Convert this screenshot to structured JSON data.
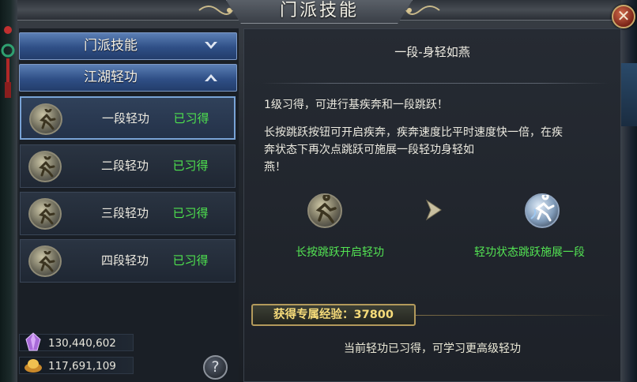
{
  "window": {
    "title": "门派技能",
    "close_glyph": "✕"
  },
  "sidebar": {
    "categories": [
      {
        "label": "门派技能",
        "expanded": false
      },
      {
        "label": "江湖轻功",
        "expanded": true
      }
    ],
    "skills": [
      {
        "name": "一段轻功",
        "status": "已习得",
        "selected": true
      },
      {
        "name": "二段轻功",
        "status": "已习得",
        "selected": false
      },
      {
        "name": "三段轻功",
        "status": "已习得",
        "selected": false
      },
      {
        "name": "四段轻功",
        "status": "已习得",
        "selected": false
      }
    ],
    "currencies": [
      {
        "icon": "crystal-icon",
        "value": "130,440,602"
      },
      {
        "icon": "ingot-icon",
        "value": "117,691,109"
      }
    ],
    "help_glyph": "?"
  },
  "detail": {
    "title": "一段-身轻如燕",
    "line1": "1级习得，可进行基疾奔和一段跳跃！",
    "line2": "长按跳跃按钮可开启疾奔，疾奔速度比平时速度快一倍，在疾",
    "line3": "奔状态下再次点跳跃可施展一段轻功身轻如",
    "line4": "燕！",
    "demo_left_label": "长按跳跃开启轻功",
    "demo_right_label": "轻功状态跳跃施展一段",
    "exp_label": "获得专属经验：37800",
    "footer": "当前轻功已习得，可学习更高级轻功"
  },
  "colors": {
    "learned": "#4ee24e",
    "accent_gold": "#f7dc7a",
    "header_blue": "#2f4f86"
  }
}
